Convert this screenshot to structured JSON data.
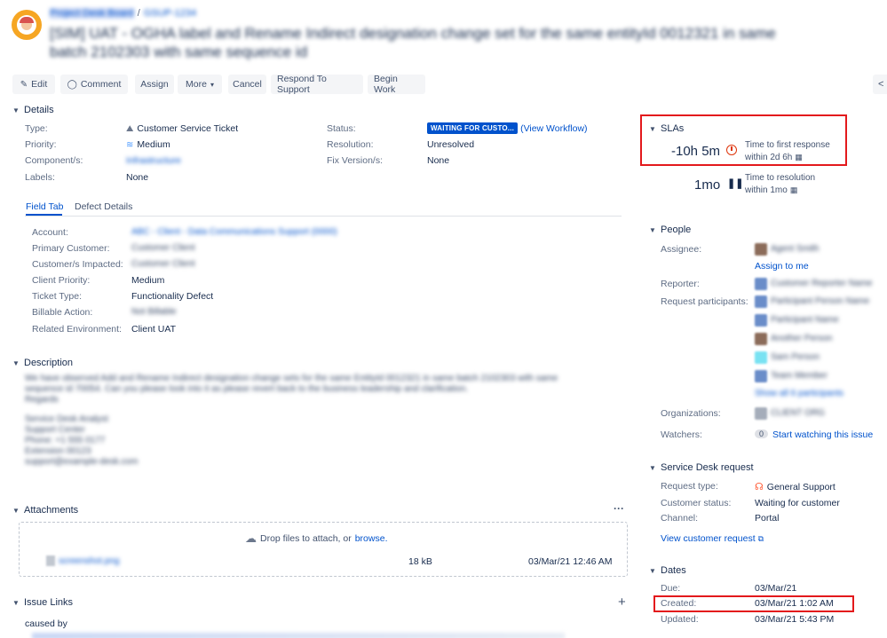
{
  "header": {
    "breadcrumb_project": "Project Desk Board",
    "breadcrumb_sep": "/",
    "breadcrumb_key": "GSUP-1234",
    "title": "[SIM] UAT - OGHA label and Rename Indirect designation change set for the same entityId 0012321 in same batch 2102303 with same sequence id"
  },
  "toolbar": {
    "edit": "Edit",
    "comment": "Comment",
    "assign": "Assign",
    "more": "More",
    "cancel": "Cancel",
    "respond": "Respond To Support",
    "begin_work": "Begin Work"
  },
  "details": {
    "title": "Details",
    "type_label": "Type:",
    "type_value": "Customer Service Ticket",
    "priority_label": "Priority:",
    "priority_value": "Medium",
    "components_label": "Component/s:",
    "components_value": "Infrastructure",
    "labels_label": "Labels:",
    "labels_value": "None",
    "status_label": "Status:",
    "status_value": "WAITING FOR CUSTO...",
    "view_workflow": "(View Workflow)",
    "resolution_label": "Resolution:",
    "resolution_value": "Unresolved",
    "fixversion_label": "Fix Version/s:",
    "fixversion_value": "None"
  },
  "tabs": {
    "field_tab": "Field Tab",
    "defect_details": "Defect Details"
  },
  "fields": {
    "account_label": "Account:",
    "account_value": "ABC - Client - Data Communications Support (0000)",
    "primary_customer_label": "Primary Customer:",
    "primary_customer_value": "Customer Client",
    "customers_impacted_label": "Customer/s Impacted:",
    "customers_impacted_value": "Customer Client",
    "client_priority_label": "Client Priority:",
    "client_priority_value": "Medium",
    "ticket_type_label": "Ticket Type:",
    "ticket_type_value": "Functionality Defect",
    "billable_action_label": "Billable Action:",
    "billable_action_value": "Not Billable",
    "related_env_label": "Related Environment:",
    "related_env_value": "Client UAT"
  },
  "description": {
    "title": "Description",
    "line1": "We have observed Add and Rename Indirect designation change sets for the same EntityId 0012321 in same batch 2102303 with same",
    "line2": "sequence id 70054. Can you please look into it as please revert back to the business leadership and clarification.",
    "line3": "Regards",
    "sig1": "Service Desk Analyst",
    "sig2": "Support Center",
    "sig3": "Phone: +1 555 0177",
    "sig4": "Extension 00123",
    "sig5": "support@example-desk.com"
  },
  "attachments": {
    "title": "Attachments",
    "drop_text": "Drop files to attach, or",
    "browse": "browse.",
    "file_name": "screenshot.png",
    "file_size": "18 kB",
    "file_date": "03/Mar/21 12:46 AM",
    "more": "···"
  },
  "issue_links": {
    "title": "Issue Links",
    "caused_by": "caused by",
    "add": "+"
  },
  "slas": {
    "title": "SLAs",
    "first_value": "-10h 5m",
    "first_label": "Time to first response",
    "first_within": "within 2d 6h",
    "resolution_value": "1mo",
    "resolution_label": "Time to resolution",
    "resolution_within": "within 1mo"
  },
  "people": {
    "title": "People",
    "assignee_label": "Assignee:",
    "assignee_value": "Agent Smith",
    "assign_to_me": "Assign to me",
    "reporter_label": "Reporter:",
    "reporter_value": "Customer Reporter Name",
    "participants_label": "Request participants:",
    "participants": [
      "Participant Person Name",
      "Participant Name",
      "Another Person",
      "Sam Person",
      "Team Member"
    ],
    "show_all": "Show all 6 participants",
    "organizations_label": "Organizations:",
    "organizations_value": "CLIENT ORG",
    "watchers_label": "Watchers:",
    "watchers_count": "0",
    "start_watching": "Start watching this issue"
  },
  "service_desk": {
    "title": "Service Desk request",
    "request_type_label": "Request type:",
    "request_type_value": "General Support",
    "customer_status_label": "Customer status:",
    "customer_status_value": "Waiting for customer",
    "channel_label": "Channel:",
    "channel_value": "Portal",
    "view_request": "View customer request"
  },
  "dates": {
    "title": "Dates",
    "due_label": "Due:",
    "due_value": "03/Mar/21",
    "created_label": "Created:",
    "created_value": "03/Mar/21 1:02 AM",
    "updated_label": "Updated:",
    "updated_value": "03/Mar/21 5:43 PM"
  },
  "colors": {
    "accent": "#0052cc",
    "highlight": "#e3191c",
    "sla_breached": "#de350b",
    "status_badge": "#0052cc"
  }
}
